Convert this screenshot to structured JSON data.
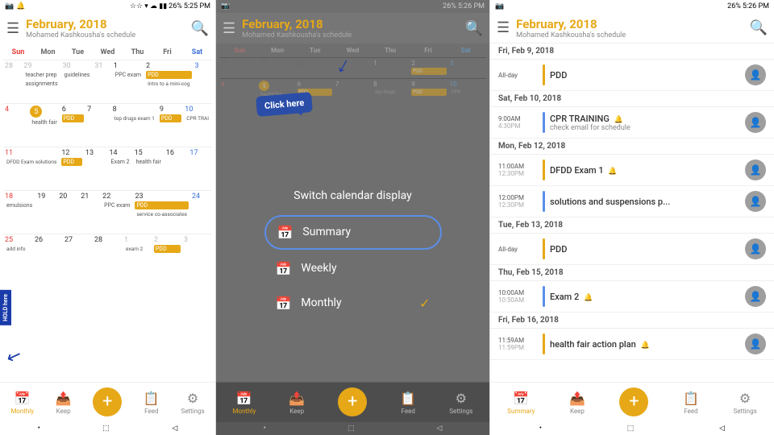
{
  "panels": {
    "p1": {
      "status": {
        "left": [
          "📷",
          "🔔"
        ],
        "right": [
          "26%",
          "5:25 PM"
        ]
      },
      "header": {
        "title": "February, 2018",
        "subtitle": "Mohamed Kashkousha's schedule",
        "hamburger": "☰",
        "search": "🔍"
      },
      "day_headers": [
        "Sun",
        "Mon",
        "Tue",
        "Wed",
        "Thu",
        "Fri",
        "Sat"
      ],
      "weeks": [
        {
          "days": [
            {
              "num": "28",
              "cls": "other-month sun-num",
              "events": []
            },
            {
              "num": "29",
              "cls": "other-month",
              "events": [
                "teacher prep",
                "assignments"
              ]
            },
            {
              "num": "30",
              "cls": "other-month",
              "events": [
                "guidelines"
              ]
            },
            {
              "num": "31",
              "cls": "other-month",
              "events": []
            },
            {
              "num": "1",
              "cls": "",
              "events": [
                "PPC exam"
              ]
            },
            {
              "num": "2",
              "cls": "",
              "events": [
                "PDD",
                "Intro to a mini-cog"
              ]
            },
            {
              "num": "3",
              "cls": "sat-num",
              "events": []
            }
          ]
        },
        {
          "days": [
            {
              "num": "4",
              "cls": "sun-num",
              "events": []
            },
            {
              "num": "5",
              "cls": "today",
              "events": [
                "health fair"
              ]
            },
            {
              "num": "6",
              "cls": "",
              "events": [
                "PDD"
              ]
            },
            {
              "num": "7",
              "cls": "",
              "events": []
            },
            {
              "num": "8",
              "cls": "",
              "events": [
                "top drugs exam 1"
              ]
            },
            {
              "num": "9",
              "cls": "",
              "events": [
                "PDD"
              ]
            },
            {
              "num": "10",
              "cls": "sat-num",
              "events": [
                "CPR TRAI"
              ]
            }
          ]
        },
        {
          "days": [
            {
              "num": "11",
              "cls": "sun-num",
              "events": [
                "DFDD Exam solutions"
              ]
            },
            {
              "num": "12",
              "cls": "",
              "events": [
                "PDD"
              ]
            },
            {
              "num": "13",
              "cls": "",
              "events": []
            },
            {
              "num": "14",
              "cls": "",
              "events": [
                "Exam 2"
              ]
            },
            {
              "num": "15",
              "cls": "",
              "events": [
                "health fair"
              ]
            },
            {
              "num": "16",
              "cls": "",
              "events": []
            },
            {
              "num": "17",
              "cls": "sat-num",
              "events": []
            }
          ]
        },
        {
          "days": [
            {
              "num": "18",
              "cls": "sun-num",
              "events": [
                "emulsions"
              ]
            },
            {
              "num": "19",
              "cls": "",
              "events": []
            },
            {
              "num": "20",
              "cls": "",
              "events": []
            },
            {
              "num": "21",
              "cls": "",
              "events": []
            },
            {
              "num": "22",
              "cls": "",
              "events": [
                "PPC exam"
              ]
            },
            {
              "num": "23",
              "cls": "",
              "events": [
                "PDD",
                "service co-associates"
              ]
            },
            {
              "num": "24",
              "cls": "sat-num",
              "events": []
            }
          ]
        },
        {
          "days": [
            {
              "num": "25",
              "cls": "sun-num",
              "events": [
                "add info"
              ]
            },
            {
              "num": "26",
              "cls": "",
              "events": []
            },
            {
              "num": "27",
              "cls": "",
              "events": []
            },
            {
              "num": "28",
              "cls": "",
              "events": []
            },
            {
              "num": "1",
              "cls": "other-month",
              "events": [
                "exam 2"
              ]
            },
            {
              "num": "2",
              "cls": "other-month",
              "events": [
                "PDD"
              ]
            },
            {
              "num": "3",
              "cls": "other-month sat-num",
              "events": []
            }
          ]
        }
      ],
      "bottom_nav": [
        {
          "icon": "📅",
          "label": "Monthly",
          "active": true
        },
        {
          "icon": "📤",
          "label": "Keep",
          "active": false
        },
        {
          "icon": "+",
          "label": "",
          "fab": true
        },
        {
          "icon": "📋",
          "label": "Feed",
          "active": false
        },
        {
          "icon": "⚙",
          "label": "Settings",
          "active": false
        }
      ],
      "bottom_indicators": [
        "•",
        "⬚",
        "☐",
        "◁"
      ]
    },
    "p2": {
      "status": {
        "right": [
          "26%",
          "5:26 PM"
        ]
      },
      "header": {
        "title": "February, 2018",
        "subtitle": "Mohamed Kashkousha's schedule"
      },
      "switch_title": "Switch calendar display",
      "view_options": [
        {
          "icon": "📅",
          "label": "Summary",
          "highlighted": true,
          "check": false
        },
        {
          "icon": "📅",
          "label": "Weekly",
          "highlighted": false,
          "check": false
        },
        {
          "icon": "📅",
          "label": "Monthly",
          "highlighted": false,
          "check": true
        }
      ],
      "click_here": "Click here",
      "hold_here": "HOLD here"
    },
    "p3": {
      "status": {
        "right": [
          "26%",
          "5:26 PM"
        ]
      },
      "header": {
        "title": "February, 2018",
        "subtitle": "Mohamed Kashkousha's schedule"
      },
      "schedule": [
        {
          "date": "Fri, Feb 9, 2018",
          "items": [
            {
              "allday": true,
              "title": "PDD",
              "bell": false,
              "bar": "yellow"
            }
          ]
        },
        {
          "date": "Sat, Feb 10, 2018",
          "items": [
            {
              "start": "9:00AM",
              "end": "4:30PM",
              "title": "CPR TRAINING",
              "bell": true,
              "desc": "check email for schedule",
              "bar": "blue"
            }
          ]
        },
        {
          "date": "Mon, Feb 12, 2018",
          "items": [
            {
              "start": "11:00AM",
              "end": "12:30PM",
              "title": "DFDD Exam 1",
              "bell": true,
              "bar": "yellow"
            }
          ]
        },
        {
          "date": "",
          "items": [
            {
              "start": "12:00PM",
              "end": "12:30PM",
              "title": "solutions and suspensions p...",
              "bell": false,
              "bar": "blue"
            }
          ]
        },
        {
          "date": "Tue, Feb 13, 2018",
          "items": [
            {
              "allday": true,
              "title": "PDD",
              "bell": false,
              "bar": "yellow"
            }
          ]
        },
        {
          "date": "Thu, Feb 15, 2018",
          "items": [
            {
              "start": "10:00AM",
              "end": "10:50AM",
              "title": "Exam 2",
              "bell": true,
              "bar": "blue"
            }
          ]
        },
        {
          "date": "Fri, Feb 16, 2018",
          "items": [
            {
              "start": "11:59AM",
              "end": "11:59PM",
              "title": "health fair action plan",
              "bell": true,
              "bar": "yellow"
            }
          ]
        }
      ],
      "bottom_nav": [
        {
          "icon": "📅",
          "label": "Summary",
          "active": true
        },
        {
          "icon": "📤",
          "label": "Keep",
          "active": false
        },
        {
          "icon": "+",
          "label": "",
          "fab": true
        },
        {
          "icon": "📋",
          "label": "Feed",
          "active": false
        },
        {
          "icon": "⚙",
          "label": "Settings",
          "active": false
        }
      ]
    }
  }
}
